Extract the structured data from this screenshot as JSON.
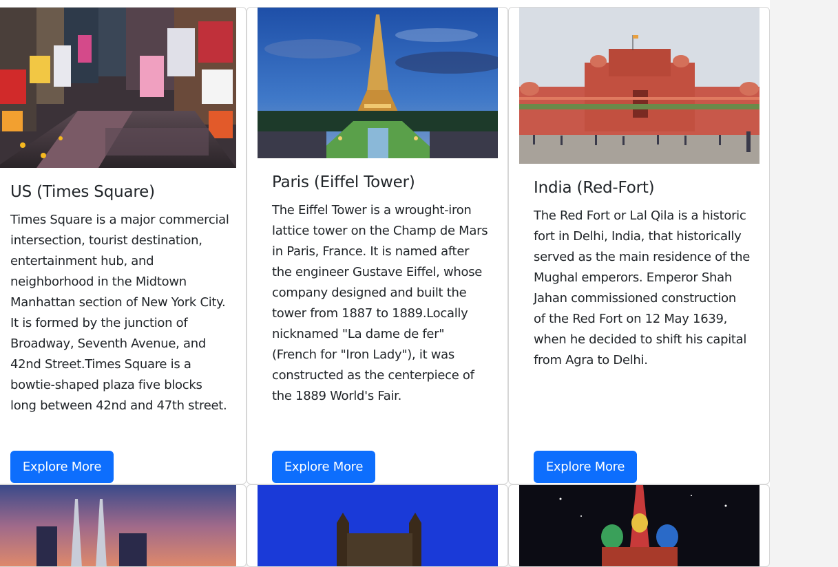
{
  "cards": [
    {
      "title": "US (Times Square)",
      "text": "Times Square is a major commercial intersection, tourist destination, entertainment hub, and neighborhood in the Midtown Manhattan section of New York City. It is formed by the junction of Broadway, Seventh Avenue, and 42nd Street.Times Square is a bowtie-shaped plaza five blocks long between 42nd and 47th street.",
      "button": "Explore More",
      "image": "times-square-photo"
    },
    {
      "title": "Paris (Eiffel Tower)",
      "text": "The Eiffel Tower is a wrought-iron lattice tower on the Champ de Mars in Paris, France. It is named after the engineer Gustave Eiffel, whose company designed and built the tower from 1887 to 1889.Locally nicknamed \"La dame de fer\" (French for \"Iron Lady\"), it was constructed as the centerpiece of the 1889 World's Fair.",
      "button": "Explore More",
      "image": "eiffel-tower-photo"
    },
    {
      "title": "India (Red-Fort)",
      "text": "The Red Fort or Lal Qila is a historic fort in Delhi, India, that historically served as the main residence of the Mughal emperors. Emperor Shah Jahan commissioned construction of the Red Fort on 12 May 1639, when he decided to shift his capital from Agra to Delhi.",
      "button": "Explore More",
      "image": "red-fort-photo"
    }
  ],
  "row2_images": [
    "petronas-towers-photo",
    "castle-night-photo",
    "st-basils-cathedral-photo"
  ],
  "colors": {
    "primary_button": "#0d6efd",
    "page_background": "#f3f3f3"
  }
}
